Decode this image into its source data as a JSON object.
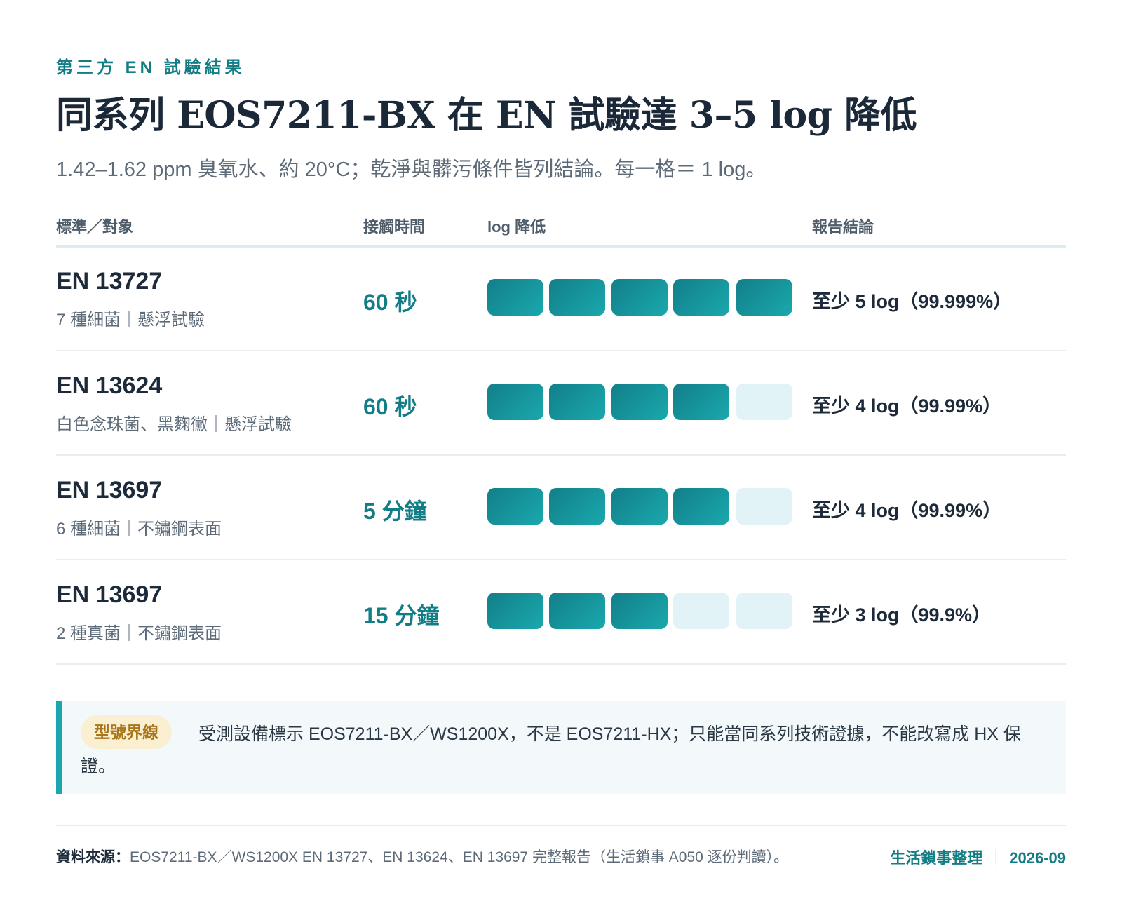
{
  "header": {
    "eyebrow": "第三方 EN 試驗結果",
    "title": "同系列 EOS7211-BX 在 EN 試驗達 3–5 log 降低",
    "subtitle": "1.42–1.62 ppm 臭氧水、約 20°C；乾淨與髒污條件皆列結論。每一格＝ 1 log。"
  },
  "table": {
    "columns": [
      "標準／對象",
      "接觸時間",
      "log 降低",
      "報告結論"
    ],
    "max_log": 5,
    "rows": [
      {
        "standard": "EN 13727",
        "object": "7 種細菌｜懸浮試驗",
        "time": "60 秒",
        "log": 5,
        "conclusion": "至少 5 log（99.999%）"
      },
      {
        "standard": "EN 13624",
        "object": "白色念珠菌、黑麴黴｜懸浮試驗",
        "time": "60 秒",
        "log": 4,
        "conclusion": "至少 4 log（99.99%）"
      },
      {
        "standard": "EN 13697",
        "object": "6 種細菌｜不鏽鋼表面",
        "time": "5 分鐘",
        "log": 4,
        "conclusion": "至少 4 log（99.99%）"
      },
      {
        "standard": "EN 13697",
        "object": "2 種真菌｜不鏽鋼表面",
        "time": "15 分鐘",
        "log": 3,
        "conclusion": "至少 3 log（99.9%）"
      }
    ]
  },
  "note": {
    "badge": "型號界線",
    "text": "受測設備標示 EOS7211-BX／WS1200X，不是 EOS7211-HX；只能當同系列技術證據，不能改寫成 HX 保證。"
  },
  "footer": {
    "source_label": "資料來源：",
    "source_text": "EOS7211-BX／WS1200X EN 13727、EN 13624、EN 13697 完整報告（生活鎖事 A050 逐份判讀）。",
    "credit": "生活鎖事整理",
    "separator": "｜",
    "date": "2026-09"
  },
  "colors": {
    "accent": "#137d86",
    "bar_on_start": "#127f89",
    "bar_on_end": "#1aa8ad",
    "bar_off": "#e1f3f6",
    "badge_bg": "#fbefd2",
    "badge_text": "#a8761a"
  }
}
